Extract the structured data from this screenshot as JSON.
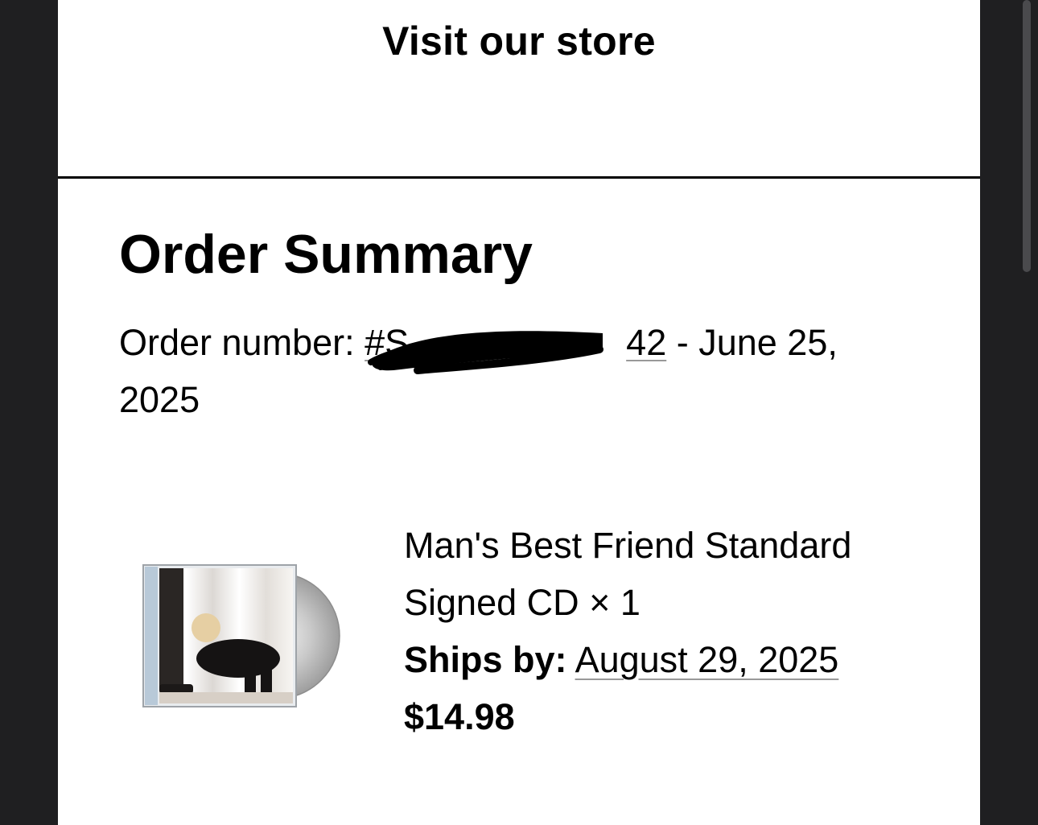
{
  "header": {
    "store_link": "Visit our store"
  },
  "order_summary": {
    "title": "Order Summary",
    "order_label": "Order number: ",
    "order_number_prefix": "#S",
    "order_number_suffix": "42",
    "order_date": " - June 25, 2025"
  },
  "item": {
    "name": "Man's Best Friend Standard Signed CD × 1",
    "ships_label": "Ships by:",
    "ships_date": "August 29, 2025",
    "price": "$14.98"
  },
  "colors": {
    "background_dark": "#1f1f21",
    "page": "#ffffff",
    "text": "#000000",
    "underline": "#999999"
  }
}
